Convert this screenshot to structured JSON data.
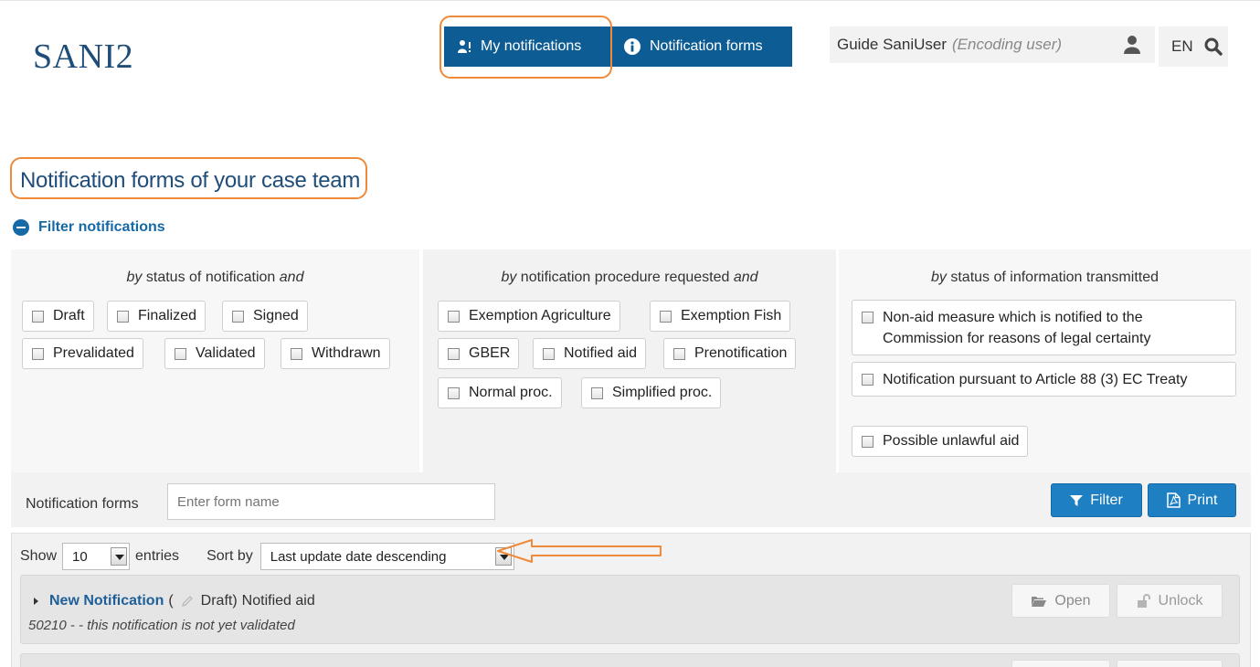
{
  "header": {
    "logo": "SANI2",
    "nav": {
      "my_notifications": "My notifications",
      "notification_forms": "Notification forms"
    },
    "user": {
      "name": "Guide SaniUser",
      "role": "(Encoding user)"
    },
    "language": "EN"
  },
  "page_title": "Notification forms of your case team",
  "filter": {
    "toggle_label": "Filter notifications",
    "status_panel": {
      "heading_prefix": "by",
      "heading_text": "status of notification",
      "heading_suffix": "and",
      "options": [
        "Draft",
        "Finalized",
        "Signed",
        "Prevalidated",
        "Validated",
        "Withdrawn"
      ]
    },
    "procedure_panel": {
      "heading_prefix": "by",
      "heading_text": "notification procedure requested",
      "heading_suffix": "and",
      "options": [
        "Exemption Agriculture",
        "Exemption Fish",
        "GBER",
        "Notified aid",
        "Prenotification",
        "Normal proc.",
        "Simplified proc."
      ]
    },
    "info_panel": {
      "heading_prefix": "by",
      "heading_text": "status of information transmitted",
      "options": [
        "Non-aid measure which is notified to the Commission for reasons of legal certainty",
        "Notification pursuant to Article 88 (3) EC Treaty",
        "Possible unlawful aid"
      ]
    }
  },
  "search": {
    "label": "Notification forms",
    "placeholder": "Enter form name",
    "filter_button": "Filter",
    "print_button": "Print"
  },
  "list_controls": {
    "show_label": "Show",
    "entries_value": "10",
    "entries_label": "entries",
    "sort_label": "Sort by",
    "sort_value": "Last update date descending"
  },
  "items": [
    {
      "title": "New Notification",
      "open_paren": "(",
      "status": "Draft)",
      "type": "Notified aid",
      "subtitle": "50210 - - this notification is not yet validated",
      "open_button": "Open",
      "unlock_button": "Unlock"
    }
  ],
  "colors": {
    "primary": "#0e5c94",
    "button_blue": "#1e7fc2",
    "title_blue": "#1f4d7a",
    "annotation": "#ef8a3a"
  }
}
